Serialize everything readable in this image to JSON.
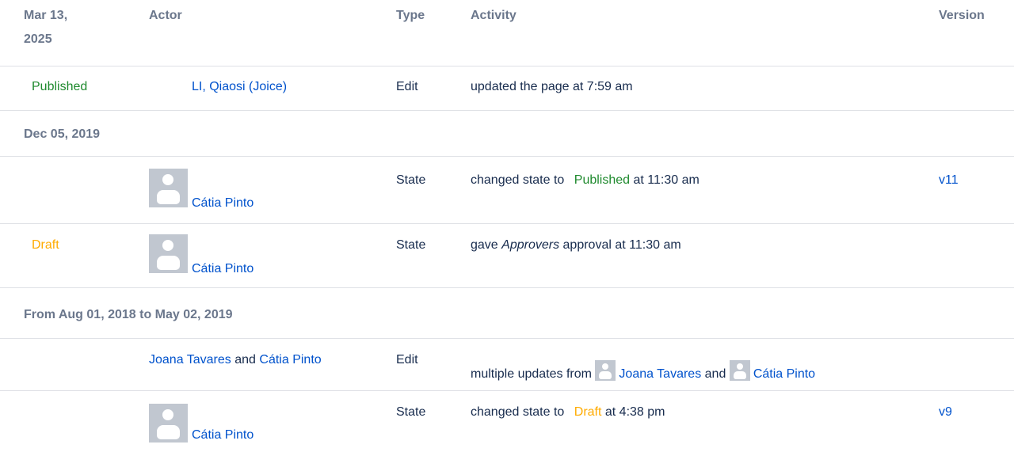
{
  "header": {
    "date_line1": "Mar 13,",
    "date_line2": "2025",
    "actor": "Actor",
    "type": "Type",
    "activity": "Activity",
    "version": "Version"
  },
  "row1": {
    "status": "Published",
    "actor": "LI, Qiaosi (Joice)",
    "type": "Edit",
    "activity": "updated the page at 7:59 am"
  },
  "section_dec": "Dec 05, 2019",
  "row2": {
    "actor": "Cátia Pinto",
    "type": "State",
    "activity_prefix": "changed state to",
    "state": "Published",
    "activity_suffix": "at 11:30 am",
    "version": "v11"
  },
  "row3": {
    "status": "Draft",
    "actor": "Cátia Pinto",
    "type": "State",
    "activity_prefix": "gave",
    "activity_group": "Approvers",
    "activity_suffix": "approval at 11:30 am"
  },
  "section_range": "From Aug 01, 2018 to May 02, 2019",
  "row4": {
    "actor1": "Joana Tavares",
    "and": "and",
    "actor2": "Cátia Pinto",
    "type": "Edit",
    "activity_prefix": "multiple updates from",
    "activity_user1": "Joana Tavares",
    "activity_and": "and",
    "activity_user2": "Cátia Pinto"
  },
  "row5": {
    "actor": "Cátia Pinto",
    "type": "State",
    "activity_prefix": "changed state to",
    "state": "Draft",
    "activity_suffix": "at 4:38 pm",
    "version": "v9"
  },
  "colors": {
    "link": "#0052cc",
    "published": "#1f8a2e",
    "draft": "#ffab00",
    "header_text": "#6b778c",
    "separator": "#dfe1e6"
  },
  "icons": [
    "user-avatar-icon"
  ]
}
